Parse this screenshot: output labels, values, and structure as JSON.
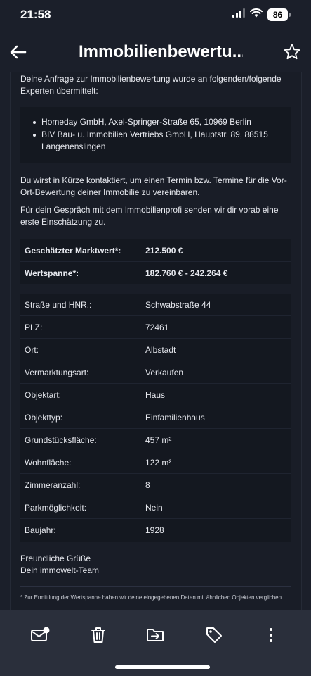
{
  "status_bar": {
    "time": "21:58",
    "battery": "86"
  },
  "header": {
    "title": "Immobilienbewertu..."
  },
  "intro": "Deine Anfrage zur Immobilienbewertung wurde an folgenden/folgende Experten übermittelt:",
  "experts": [
    "Homeday GmbH, Axel-Springer-Straße 65, 10969 Berlin",
    "BIV Bau- u. Immobilien Vertriebs GmbH, Hauptstr. 89, 88515 Langenenslingen"
  ],
  "contact_text": "Du wirst in Kürze kontaktiert, um einen Termin bzw. Termine für die Vor-Ort-Bewertung deiner Immobilie zu vereinbaren.",
  "gespraech_text": "Für dein Gespräch mit dem Immobilienprofi senden wir dir vorab eine erste Einschätzung zu.",
  "valuation": [
    {
      "label": "Geschätzter Marktwert*:",
      "value": "212.500 €"
    },
    {
      "label": "Wertspanne*:",
      "value": "182.760 € - 242.264 €"
    }
  ],
  "details": [
    {
      "label": "Straße und HNR.:",
      "value": "Schwabstraße 44"
    },
    {
      "label": "PLZ:",
      "value": "72461"
    },
    {
      "label": "Ort:",
      "value": "Albstadt"
    },
    {
      "label": "Vermarktungsart:",
      "value": "Verkaufen"
    },
    {
      "label": "Objektart:",
      "value": "Haus"
    },
    {
      "label": "Objekttyp:",
      "value": "Einfamilienhaus"
    },
    {
      "label": "Grundstücksfläche:",
      "value": "457 m²"
    },
    {
      "label": "Wohnfläche:",
      "value": "122 m²"
    },
    {
      "label": "Zimmeranzahl:",
      "value": "8"
    },
    {
      "label": "Parkmöglichkeit:",
      "value": "Nein"
    },
    {
      "label": "Baujahr:",
      "value": "1928"
    }
  ],
  "greeting": {
    "line1": "Freundliche Grüße",
    "line2": "Dein immowelt-Team"
  },
  "footnote": "* Zur Ermittlung der Wertspanne haben wir deine eingegebenen Daten mit ähnlichen Objekten verglichen.",
  "toolbar": {
    "icons": [
      "mark-unread-icon",
      "trash-icon",
      "move-to-folder-icon",
      "tag-icon",
      "more-icon"
    ]
  },
  "colors": {
    "background": "#1b1f2a",
    "panel": "#141820",
    "toolbar": "#2a2f3b",
    "text": "#e6e8ee"
  }
}
